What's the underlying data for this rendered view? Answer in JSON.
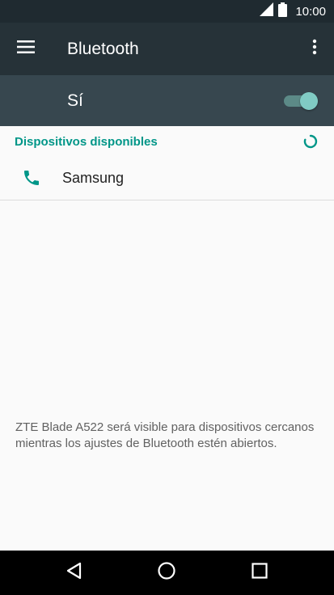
{
  "status_bar": {
    "time": "10:00",
    "icons": [
      "signal-icon",
      "battery-icon"
    ]
  },
  "app_bar": {
    "title": "Bluetooth",
    "menu_icon": "hamburger-menu-icon",
    "overflow_icon": "more-vert-icon"
  },
  "master_switch": {
    "label": "Sí",
    "on": true,
    "accent": "#80cbc4"
  },
  "available_devices": {
    "header": "Dispositivos disponibles",
    "scanning_icon": "progress-spinner-icon",
    "devices": [
      {
        "name": "Samsung",
        "icon": "phone-icon"
      }
    ]
  },
  "visibility_note": "ZTE Blade A522 será visible para dispositivos cercanos mientras los ajustes de Bluetooth estén abiertos.",
  "nav_bar": {
    "buttons": [
      "back-icon",
      "home-icon",
      "recents-icon"
    ]
  },
  "colors": {
    "app_bar": "#263238",
    "switch_bar": "#37474f",
    "accent": "#009688"
  }
}
